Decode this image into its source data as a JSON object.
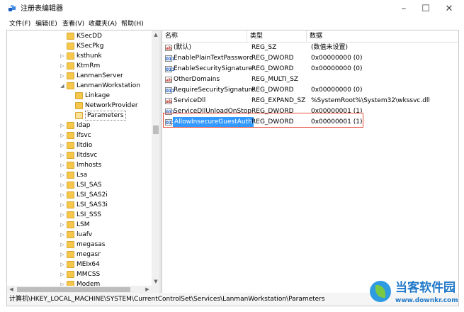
{
  "window": {
    "title": "注册表编辑器",
    "controls": {
      "minimize": "–",
      "maximize": "☐",
      "close": "✕"
    }
  },
  "menu": [
    "文件(F)",
    "编辑(E)",
    "查看(V)",
    "收藏夹(A)",
    "帮助(H)"
  ],
  "tree": {
    "items": [
      {
        "label": "KSecDD",
        "level": 0,
        "expander": "none"
      },
      {
        "label": "KSecPkg",
        "level": 0,
        "expander": "none"
      },
      {
        "label": "ksthunk",
        "level": 0,
        "expander": "collapsed"
      },
      {
        "label": "KtmRm",
        "level": 0,
        "expander": "collapsed"
      },
      {
        "label": "LanmanServer",
        "level": 0,
        "expander": "collapsed"
      },
      {
        "label": "LanmanWorkstation",
        "level": 0,
        "expander": "expanded"
      },
      {
        "label": "Linkage",
        "level": 1,
        "expander": "none"
      },
      {
        "label": "NetworkProvider",
        "level": 1,
        "expander": "none"
      },
      {
        "label": "Parameters",
        "level": 1,
        "expander": "none",
        "selected": true
      },
      {
        "label": "ldap",
        "level": 0,
        "expander": "collapsed"
      },
      {
        "label": "lfsvc",
        "level": 0,
        "expander": "collapsed"
      },
      {
        "label": "lltdio",
        "level": 0,
        "expander": "collapsed"
      },
      {
        "label": "lltdsvc",
        "level": 0,
        "expander": "collapsed"
      },
      {
        "label": "lmhosts",
        "level": 0,
        "expander": "collapsed"
      },
      {
        "label": "Lsa",
        "level": 0,
        "expander": "collapsed"
      },
      {
        "label": "LSI_SAS",
        "level": 0,
        "expander": "collapsed"
      },
      {
        "label": "LSI_SAS2i",
        "level": 0,
        "expander": "collapsed"
      },
      {
        "label": "LSI_SAS3i",
        "level": 0,
        "expander": "collapsed"
      },
      {
        "label": "LSI_SSS",
        "level": 0,
        "expander": "collapsed"
      },
      {
        "label": "LSM",
        "level": 0,
        "expander": "collapsed"
      },
      {
        "label": "luafv",
        "level": 0,
        "expander": "collapsed"
      },
      {
        "label": "megasas",
        "level": 0,
        "expander": "collapsed"
      },
      {
        "label": "megasr",
        "level": 0,
        "expander": "collapsed"
      },
      {
        "label": "MEIx64",
        "level": 0,
        "expander": "collapsed"
      },
      {
        "label": "MMCSS",
        "level": 0,
        "expander": "collapsed"
      },
      {
        "label": "Modem",
        "level": 0,
        "expander": "collapsed"
      }
    ]
  },
  "list": {
    "columns": [
      "名称",
      "类型",
      "数据"
    ],
    "rows": [
      {
        "icon": "ab",
        "name": "(默认)",
        "type": "REG_SZ",
        "data": "(数值未设置)"
      },
      {
        "icon": "bin",
        "name": "EnablePlainTextPassword",
        "type": "REG_DWORD",
        "data": "0x00000000 (0)"
      },
      {
        "icon": "bin",
        "name": "EnableSecuritySignature",
        "type": "REG_DWORD",
        "data": "0x00000000 (0)"
      },
      {
        "icon": "ab",
        "name": "OtherDomains",
        "type": "REG_MULTI_SZ",
        "data": ""
      },
      {
        "icon": "bin",
        "name": "RequireSecuritySignature",
        "type": "REG_DWORD",
        "data": "0x00000000 (0)"
      },
      {
        "icon": "ab",
        "name": "ServiceDll",
        "type": "REG_EXPAND_SZ",
        "data": "%SystemRoot%\\System32\\wkssvc.dll"
      },
      {
        "icon": "bin",
        "name": "ServiceDllUnloadOnStop",
        "type": "REG_DWORD",
        "data": "0x00000001 (1)"
      },
      {
        "icon": "bin",
        "name": "AllowInsecureGuestAuth",
        "type": "REG_DWORD",
        "data": "0x00000001 (1)",
        "selected": true
      }
    ]
  },
  "status": {
    "path": "计算机\\HKEY_LOCAL_MACHINE\\SYSTEM\\CurrentControlSet\\Services\\LanmanWorkstation\\Parameters"
  },
  "watermark": {
    "cn": "当客软件园",
    "en": "www.downkr.com"
  },
  "colors": {
    "selection": "#3399ff",
    "highlight": "#e74c3c",
    "folder": "#f5c84b",
    "watermark": "#1f78c8"
  }
}
